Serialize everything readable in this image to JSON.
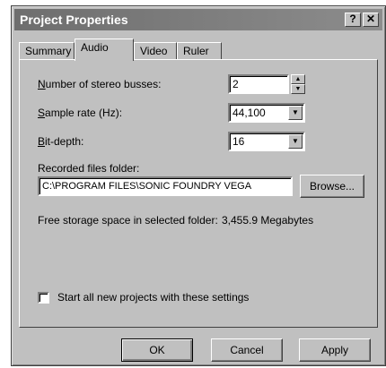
{
  "window": {
    "title": "Project Properties",
    "help_glyph": "?",
    "close_glyph": "✕"
  },
  "tabs": [
    {
      "label": "Summary",
      "active": false
    },
    {
      "label": "Audio",
      "active": true
    },
    {
      "label": "Video",
      "active": false
    },
    {
      "label": "Ruler",
      "active": false
    }
  ],
  "audio": {
    "stereo_busses": {
      "label_underline": "N",
      "label_rest": "umber of stereo busses:",
      "value": "2"
    },
    "sample_rate": {
      "label_underline": "S",
      "label_rest": "ample rate (Hz):",
      "value": "44,100"
    },
    "bit_depth": {
      "label_underline": "B",
      "label_rest": "it-depth:",
      "value": "16"
    },
    "recorded_folder": {
      "label": "Recorded files folder:",
      "value": "C:\\PROGRAM FILES\\SONIC FOUNDRY VEGA",
      "browse_label": "Browse..."
    },
    "free_space": {
      "label": "Free storage space in selected folder:",
      "value": "3,455.9 Megabytes"
    },
    "start_all_new": {
      "label": "Start all new projects with these settings",
      "checked": false
    }
  },
  "buttons": {
    "ok": "OK",
    "cancel": "Cancel",
    "apply": "Apply"
  },
  "icons": {
    "spin_up": "▲",
    "spin_down": "▼",
    "dropdown": "▼"
  }
}
